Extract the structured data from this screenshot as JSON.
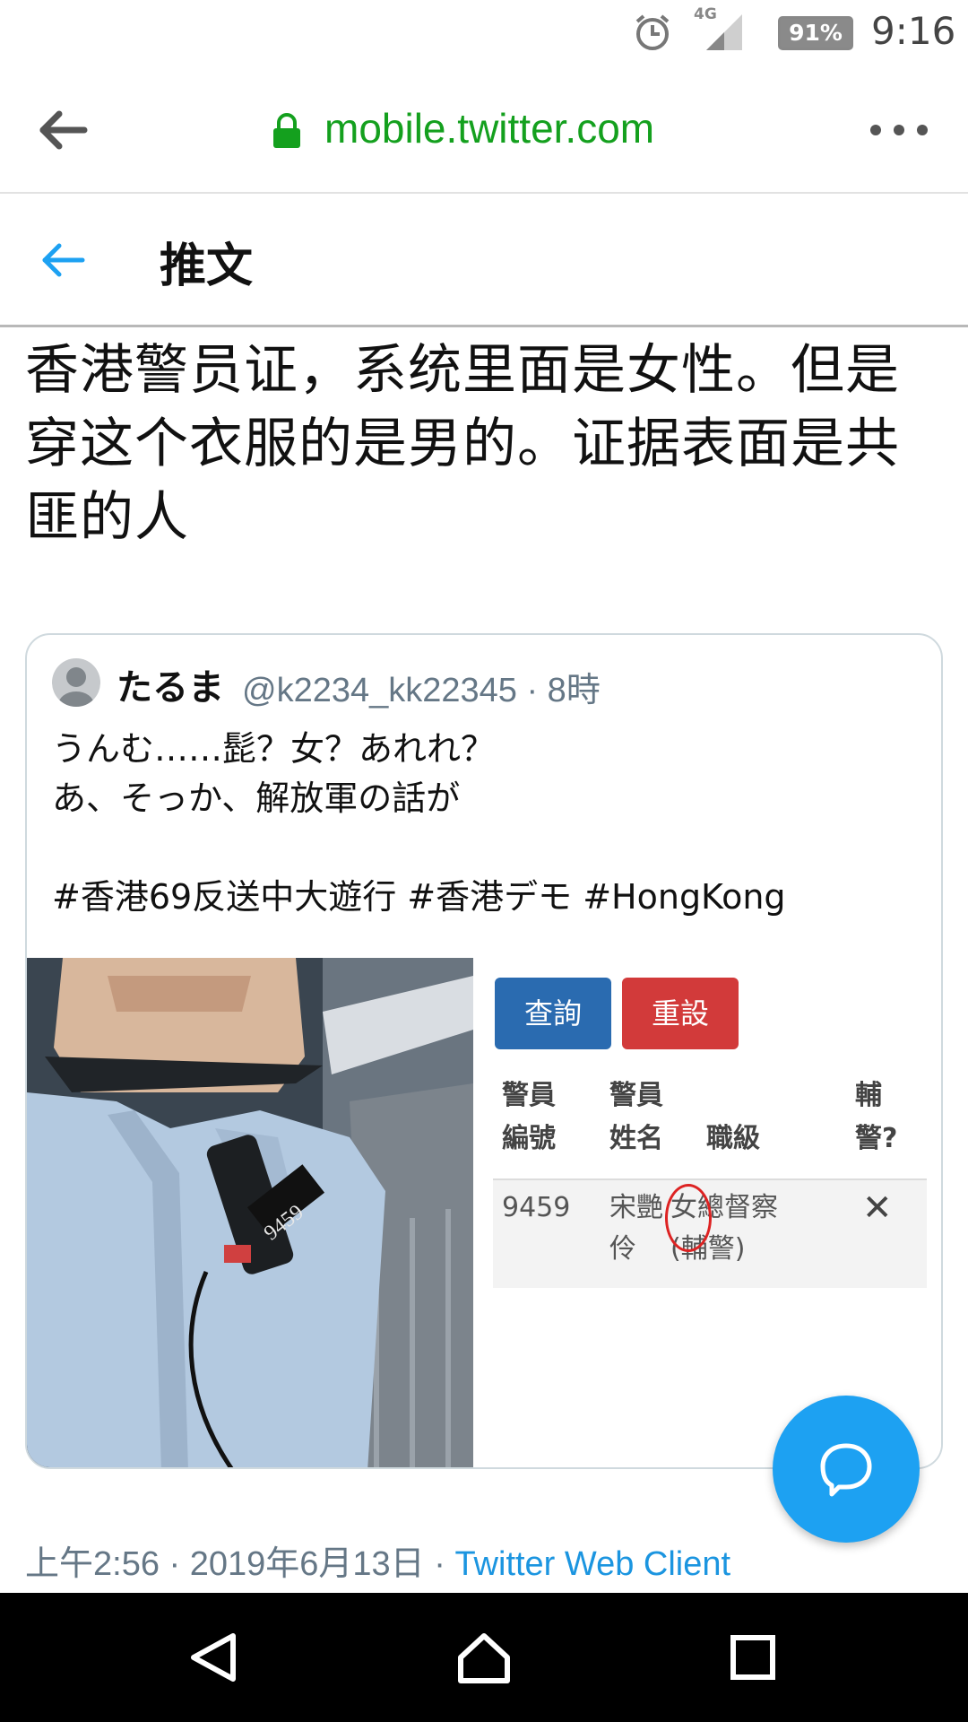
{
  "status_bar": {
    "network": "4G",
    "battery": "91%",
    "time": "9:16"
  },
  "browser": {
    "url": "mobile.twitter.com"
  },
  "header": {
    "title": "推文"
  },
  "tweet": {
    "text": "香港警员证，系统里面是女性。但是穿这个衣服的是男的。证据表面是共匪的人",
    "timestamp": "上午2:56 · 2019年6月13日 · ",
    "client": "Twitter Web Client"
  },
  "quoted_tweet": {
    "name": "たるま",
    "handle_time": "@k2234_kk22345 · 8時",
    "body": "うんむ……髭？女？あれれ？\nあ、そっか、解放軍の話が\n\n#香港69反送中大遊行 #香港デモ #HongKong",
    "photo_badge": "9459",
    "table": {
      "buttons": [
        "查詢",
        "重設"
      ],
      "headers": [
        "警員\n編號",
        "警員\n姓名",
        "職級",
        "輔\n警?"
      ],
      "row": {
        "id": "9459",
        "name": "宋艷\n伶",
        "rank": "女總督察\n(輔警)",
        "aux": "✕"
      }
    }
  },
  "colors": {
    "twitter_blue": "#1da1f2",
    "url_green": "#14a01e",
    "muted_gray": "#657786"
  }
}
